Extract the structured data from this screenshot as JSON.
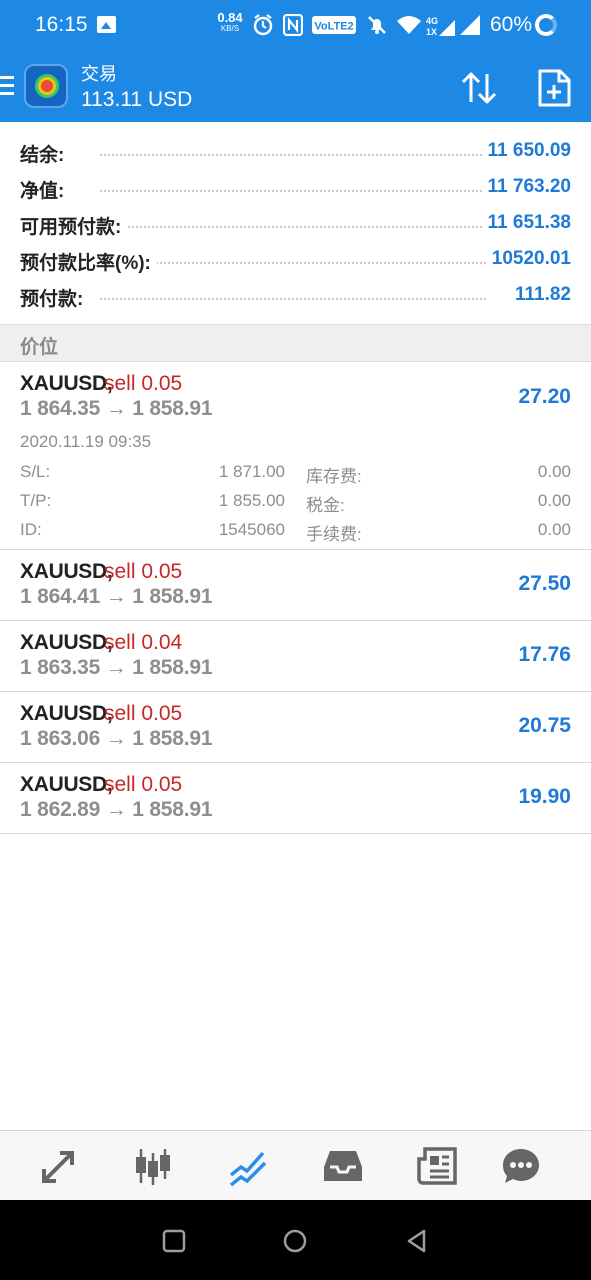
{
  "status_bar": {
    "time": "16:15",
    "net_speed": "0.84",
    "net_unit": "KB/S",
    "volte": "VoLTE2",
    "signal_label": "4G 1X",
    "battery": "60%"
  },
  "app_bar": {
    "title": "交易",
    "subtitle": "113.11 USD"
  },
  "summary": [
    {
      "label": "结余:",
      "value": "11 650.09"
    },
    {
      "label": "净值:",
      "value": "11 763.20"
    },
    {
      "label": "可用预付款:",
      "value": "11 651.38"
    },
    {
      "label": "预付款比率(%):",
      "value": "10520.01"
    },
    {
      "label": "预付款:",
      "value": "111.82"
    }
  ],
  "section_header": "价位",
  "positions": [
    {
      "symbol": "XAUUSD,",
      "side": "sell 0.05",
      "prices": "1 864.35 → 1 858.91",
      "profit": "27.20",
      "open_time": "2020.11.19 09:35",
      "sl_label": "S/L:",
      "sl": "1 871.00",
      "tp_label": "T/P:",
      "tp": "1 855.00",
      "id_label": "ID:",
      "id": "1545060",
      "swap_label": "库存费:",
      "swap": "0.00",
      "tax_label": "税金:",
      "tax": "0.00",
      "commission_label": "手续费:",
      "commission": "0.00"
    },
    {
      "symbol": "XAUUSD,",
      "side": "sell 0.05",
      "prices": "1 864.41 → 1 858.91",
      "profit": "27.50"
    },
    {
      "symbol": "XAUUSD,",
      "side": "sell 0.04",
      "prices": "1 863.35 → 1 858.91",
      "profit": "17.76"
    },
    {
      "symbol": "XAUUSD,",
      "side": "sell 0.05",
      "prices": "1 863.06 → 1 858.91",
      "profit": "20.75"
    },
    {
      "symbol": "XAUUSD,",
      "side": "sell 0.05",
      "prices": "1 862.89 → 1 858.91",
      "profit": "19.90"
    }
  ],
  "bottom_nav": [
    {
      "icon": "quotes-icon"
    },
    {
      "icon": "chart-icon"
    },
    {
      "icon": "trade-icon",
      "active": true
    },
    {
      "icon": "history-icon"
    },
    {
      "icon": "news-icon"
    },
    {
      "icon": "chat-icon"
    }
  ],
  "colors": {
    "primary": "#1e88e5",
    "profit": "#1e7ad6",
    "sell": "#c62828",
    "muted": "#8e8e8e"
  }
}
